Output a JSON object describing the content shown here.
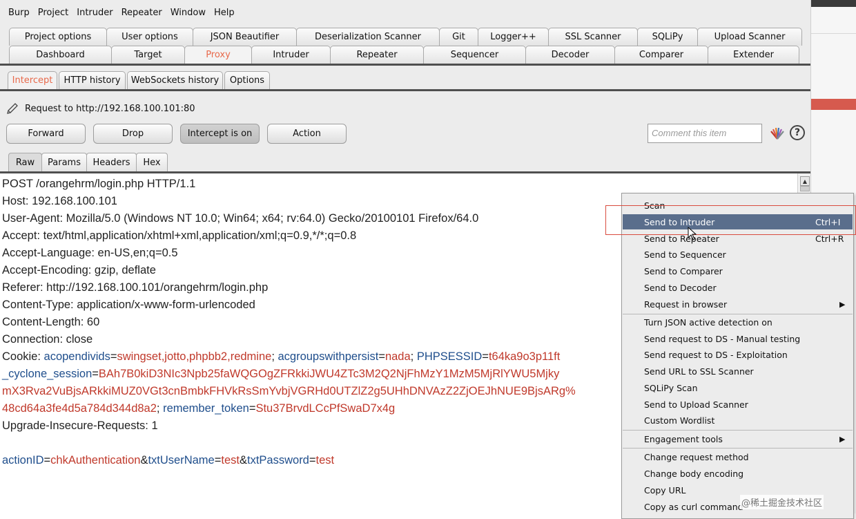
{
  "menubar": [
    "Burp",
    "Project",
    "Intruder",
    "Repeater",
    "Window",
    "Help"
  ],
  "tabs_row1": [
    "Project options",
    "User options",
    "JSON Beautifier",
    "Deserialization Scanner",
    "Git",
    "Logger++",
    "SSL Scanner",
    "SQLiPy",
    "Upload Scanner"
  ],
  "tabs_row2": [
    "Dashboard",
    "Target",
    "Proxy",
    "Intruder",
    "Repeater",
    "Sequencer",
    "Decoder",
    "Comparer",
    "Extender"
  ],
  "active_tab": "Proxy",
  "proxy_tabs": [
    "Intercept",
    "HTTP history",
    "WebSockets history",
    "Options"
  ],
  "request_info": "Request to http://192.168.100.101:80",
  "buttons": {
    "forward": "Forward",
    "drop": "Drop",
    "intercept": "Intercept is on",
    "action": "Action"
  },
  "comment_placeholder": "Comment this item",
  "help": "?",
  "editor_tabs": [
    "Raw",
    "Params",
    "Headers",
    "Hex"
  ],
  "request_lines": {
    "l1": "POST /orangehrm/login.php HTTP/1.1",
    "l2": "Host: 192.168.100.101",
    "l3": "User-Agent: Mozilla/5.0 (Windows NT 10.0; Win64; x64; rv:64.0) Gecko/20100101 Firefox/64.0",
    "l4": "Accept: text/html,application/xhtml+xml,application/xml;q=0.9,*/*;q=0.8",
    "l5": "Accept-Language: en-US,en;q=0.5",
    "l6": "Accept-Encoding: gzip, deflate",
    "l7": "Referer: http://192.168.100.101/orangehrm/login.php",
    "l8": "Content-Type: application/x-www-form-urlencoded",
    "l9": "Content-Length: 60",
    "l10": "Connection: close",
    "cookie_label": "Cookie: ",
    "c1k": "acopendivids",
    "c1v": "swingset,jotto,phpbb2,redmine",
    "c2k": "acgroupswithpersist",
    "c2v": "nada",
    "c3k": "PHPSESSID",
    "c3v": "t64ka9o3p11ft",
    "c4k": "_cyclone_session",
    "c4v": "BAh7B0kiD3NIc3Npb25faWQGOgZFRkkiJWU4ZTc3M2Q2NjFhMzY1MzM5MjRlYWU5Mjky",
    "c5v": "mX3Rva2VuBjsARkkiMUZ0VGt3cnBmbkFHVkRsSmYvbjVGRHd0UTZlZ2g5UHhDNVAzZ2ZjOEJhNUE9BjsARg%",
    "c6v": "48cd64a3fe4d5a784d344d8a2",
    "c7k": "remember_token",
    "c7v": "Stu37BrvdLCcPfSwaD7x4g",
    "l12": "Upgrade-Insecure-Requests: 1",
    "b1k": "actionID",
    "b1v": "chkAuthentication",
    "b2k": "txtUserName",
    "b2v": "test",
    "b3k": "txtPassword",
    "b3v": "test",
    "eq": "=",
    "amp": "&",
    "semi": "; "
  },
  "context_menu": {
    "scan": "Scan",
    "send_intruder": "Send to Intruder",
    "send_intruder_sc": "Ctrl+I",
    "send_repeater": "Send to Repeater",
    "send_repeater_sc": "Ctrl+R",
    "send_sequencer": "Send to Sequencer",
    "send_comparer": "Send to Comparer",
    "send_decoder": "Send to Decoder",
    "request_browser": "Request in browser",
    "turn_json": "Turn JSON active detection on",
    "ds_manual": "Send request to DS - Manual testing",
    "ds_exploit": "Send request to DS - Exploitation",
    "ssl_scanner": "Send URL to SSL Scanner",
    "sqlipy": "SQLiPy Scan",
    "upload_scanner": "Send to Upload Scanner",
    "wordlist": "Custom Wordlist",
    "engagement": "Engagement tools",
    "change_method": "Change request method",
    "change_encoding": "Change body encoding",
    "copy_url": "Copy URL",
    "copy_curl": "Copy as curl command"
  },
  "watermark": "@稀土掘金技术社区",
  "colors": {
    "accent_active_tab": "#e8694a",
    "highlight": "#5a6e8c",
    "param_name": "#1f4e8c",
    "param_value": "#c0392b",
    "annotation_box": "#d94b3e"
  }
}
